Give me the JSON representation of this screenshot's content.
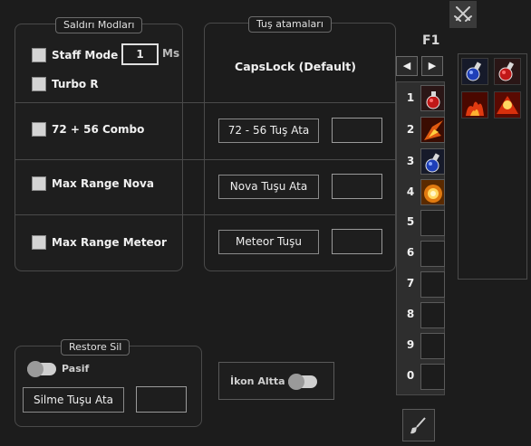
{
  "attack_modes": {
    "legend": "Saldırı Modları",
    "staff_mode": {
      "label": "Staff Mode",
      "value": "1",
      "unit": "Ms"
    },
    "turbo": {
      "label": "Turbo R"
    },
    "combo": {
      "label": "72 + 56 Combo"
    },
    "nova": {
      "label": "Max Range Nova"
    },
    "meteor": {
      "label": "Max Range Meteor"
    }
  },
  "key_bindings": {
    "legend": "Tuş atamaları",
    "default_key": "CapsLock (Default)",
    "combo_button": "72 -  56 Tuş Ata",
    "nova_button": "Nova Tuşu Ata",
    "meteor_button": "Meteor Tuşu"
  },
  "restore": {
    "legend": "Restore Sil",
    "toggle_label": "Pasif",
    "button": "Silme Tuşu Ata"
  },
  "icon_bottom": {
    "toggle_label": "İkon Altta"
  },
  "skillbar": {
    "page": "F1",
    "prev_symbol": "◀",
    "next_symbol": "▶",
    "slots": [
      {
        "number": "1",
        "icon": "red-potion-icon"
      },
      {
        "number": "2",
        "icon": "fire-skill-icon"
      },
      {
        "number": "3",
        "icon": "blue-potion-icon"
      },
      {
        "number": "4",
        "icon": "explosion-skill-icon"
      },
      {
        "number": "5",
        "icon": ""
      },
      {
        "number": "6",
        "icon": ""
      },
      {
        "number": "7",
        "icon": ""
      },
      {
        "number": "8",
        "icon": ""
      },
      {
        "number": "9",
        "icon": ""
      },
      {
        "number": "0",
        "icon": ""
      }
    ]
  },
  "inventory": {
    "icons": [
      "blue-potion-icon",
      "red-potion-icon",
      "fire-skill-icon",
      "fire-skill-icon"
    ]
  },
  "toolbar_icons": {
    "top": "crossed-swords-icon",
    "bottom": "brush-icon"
  }
}
